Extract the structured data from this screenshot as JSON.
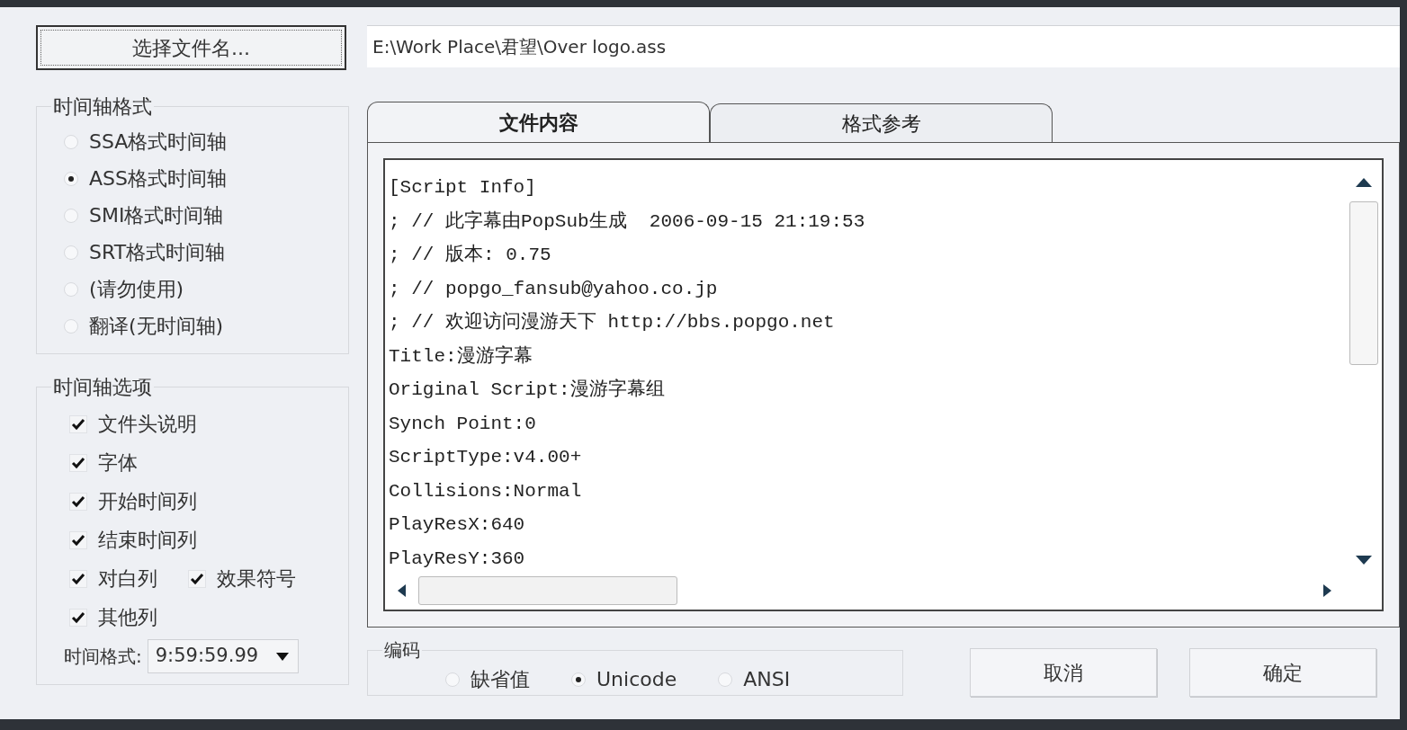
{
  "file_button": "选择文件名...",
  "file_path": "E:\\Work Place\\君望\\Over logo.ass",
  "timeline_format": {
    "title": "时间轴格式",
    "options": [
      {
        "label": "SSA格式时间轴",
        "selected": false
      },
      {
        "label": "ASS格式时间轴",
        "selected": true
      },
      {
        "label": "SMI格式时间轴",
        "selected": false
      },
      {
        "label": "SRT格式时间轴",
        "selected": false
      },
      {
        "label": "(请勿使用)",
        "selected": false
      },
      {
        "label": "翻译(无时间轴)",
        "selected": false
      }
    ]
  },
  "timeline_options": {
    "title": "时间轴选项",
    "rows": [
      [
        {
          "label": "文件头说明",
          "checked": true
        }
      ],
      [
        {
          "label": "字体",
          "checked": true
        }
      ],
      [
        {
          "label": "开始时间列",
          "checked": true
        }
      ],
      [
        {
          "label": "结束时间列",
          "checked": true
        }
      ],
      [
        {
          "label": "对白列",
          "checked": true
        },
        {
          "label": "效果符号",
          "checked": true
        }
      ],
      [
        {
          "label": "其他列",
          "checked": true
        }
      ]
    ],
    "time_format": {
      "label": "时间格式:",
      "value": "9:59:59.99"
    }
  },
  "tabs": [
    {
      "label": "文件内容",
      "selected": true
    },
    {
      "label": "格式参考",
      "selected": false
    }
  ],
  "content_lines": [
    "[Script Info]",
    "; // 此字幕由PopSub生成  2006-09-15 21:19:53",
    "; // 版本: 0.75",
    "; // popgo_fansub@yahoo.co.jp",
    "; // 欢迎访问漫游天下 http://bbs.popgo.net",
    "Title:漫游字幕",
    "Original Script:漫游字幕组",
    "Synch Point:0",
    "ScriptType:v4.00+",
    "Collisions:Normal",
    "PlayResX:640",
    "PlayResY:360"
  ],
  "encoding": {
    "title": "编码",
    "options": [
      {
        "label": "缺省值",
        "selected": false
      },
      {
        "label": "Unicode",
        "selected": true
      },
      {
        "label": "ANSI",
        "selected": false
      }
    ]
  },
  "buttons": [
    "取消",
    "确定"
  ]
}
